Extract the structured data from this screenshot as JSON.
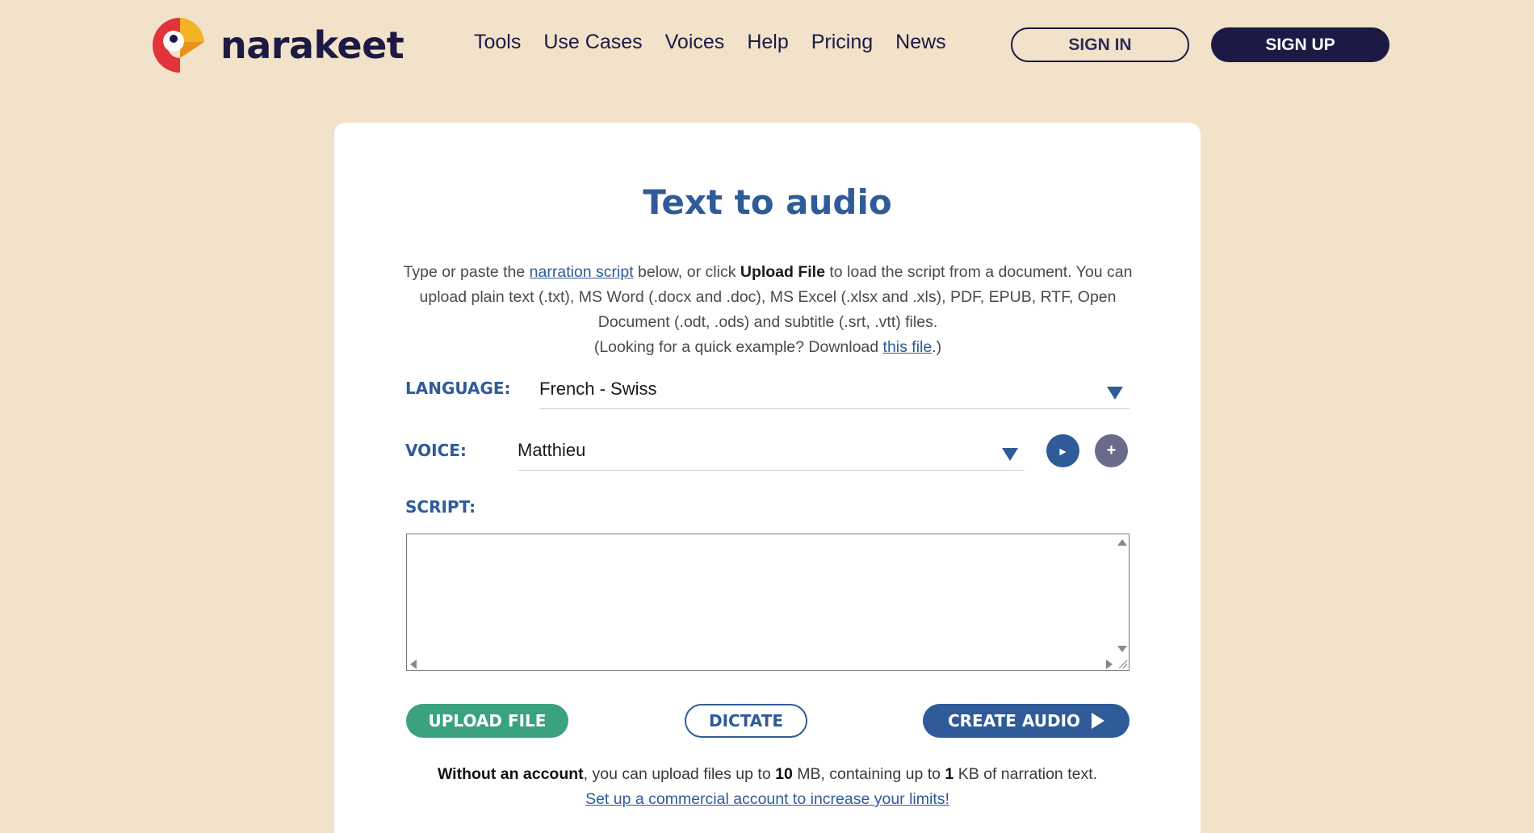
{
  "brand": {
    "name": "narakeet"
  },
  "nav": {
    "items": [
      "Tools",
      "Use Cases",
      "Voices",
      "Help",
      "Pricing",
      "News"
    ]
  },
  "auth": {
    "sign_in": "SIGN IN",
    "sign_up": "SIGN UP"
  },
  "page": {
    "title": "Text to audio",
    "intro": {
      "p1": "Type or paste the ",
      "link1": "narration script",
      "p2": " below, or click ",
      "bold1": "Upload File",
      "p3": " to load the script from a document. You can upload plain text (.txt), MS Word (.docx and .doc), MS Excel (.xlsx and .xls), PDF, EPUB, RTF, Open Document (.odt, .ods) and subtitle (.srt, .vtt) files.",
      "p4": "(Looking for a quick example? Download ",
      "link2": "this file",
      "p5": ".)"
    }
  },
  "form": {
    "language_label": "LANGUAGE:",
    "language_value": "French - Swiss",
    "voice_label": "VOICE:",
    "voice_value": "Matthieu",
    "play_icon": "►",
    "add_icon": "+",
    "script_label": "SCRIPT:",
    "script_value": ""
  },
  "actions": {
    "upload": "UPLOAD FILE",
    "dictate": "DICTATE",
    "create": "CREATE AUDIO"
  },
  "limits": {
    "b1": "Without an account",
    "t1": ", you can upload files up to ",
    "b2": "10",
    "t2": " MB, containing up to ",
    "b3": "1",
    "t3": " KB of narration text.",
    "link": "Set up a commercial account to increase your limits!"
  },
  "colors": {
    "background": "#f1e2c9",
    "brand_dark": "#1c1a44",
    "accent_blue": "#2f5b98",
    "upload_green": "#3aa37e",
    "logo_red": "#e0333a",
    "logo_yellow": "#f4b323"
  }
}
